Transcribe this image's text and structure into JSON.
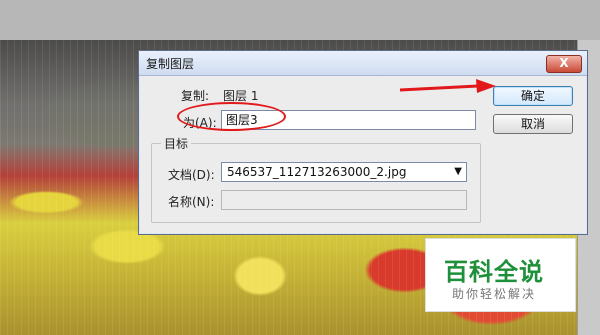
{
  "dialog": {
    "title": "复制图层",
    "close_label": "X",
    "copy_label": "复制:",
    "copy_value": "图层 1",
    "as_label": "为(A):",
    "as_value": "图层3",
    "destination_title": "目标",
    "document_label": "文档(D):",
    "document_value": "546537_112713263000_2.jpg",
    "name_label": "名称(N):",
    "name_value": "",
    "ok_label": "确定",
    "cancel_label": "取消"
  },
  "watermark": {
    "title": "百科全说",
    "subtitle": "助你轻松解决"
  },
  "colors": {
    "annotation": "#e1191b",
    "watermark_green": "#1e8f3a"
  }
}
